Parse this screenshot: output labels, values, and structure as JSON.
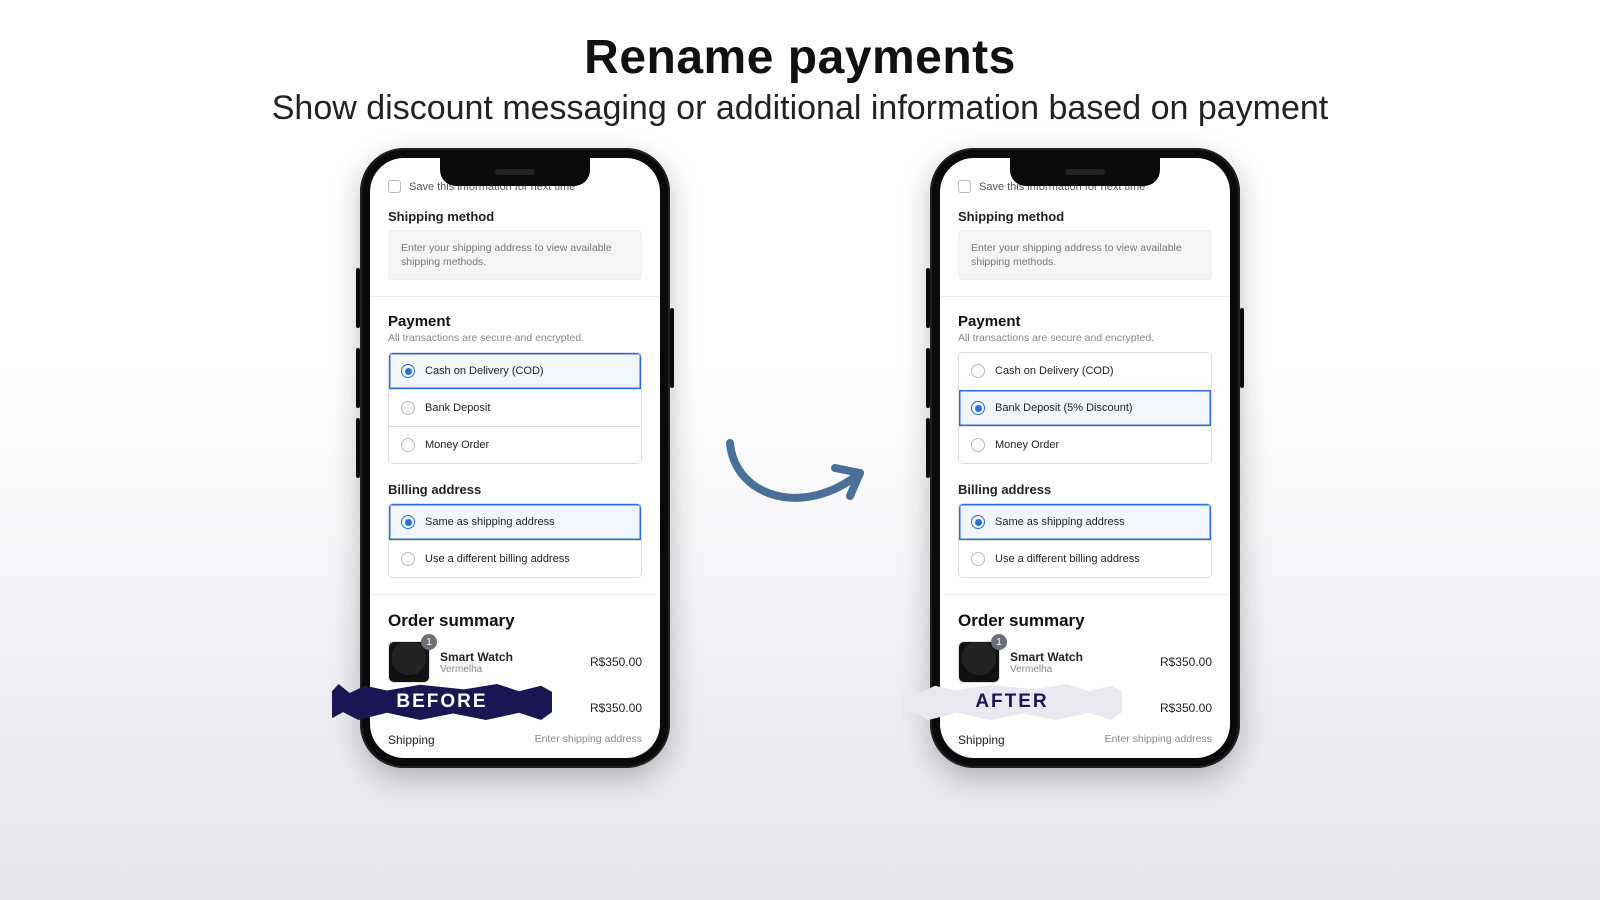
{
  "header": {
    "title": "Rename payments",
    "subtitle": "Show discount messaging or additional information based on payment"
  },
  "labels": {
    "before": "BEFORE",
    "after": "AFTER"
  },
  "checkout": {
    "save_info": "Save this information for next time",
    "shipping_method_title": "Shipping method",
    "shipping_method_hint": "Enter your shipping address to view available shipping methods.",
    "payment_title": "Payment",
    "payment_sub": "All transactions are secure and encrypted.",
    "billing_title": "Billing address",
    "billing_same": "Same as shipping address",
    "billing_diff": "Use a different billing address",
    "summary_title": "Order summary",
    "item_name": "Smart Watch",
    "item_variant": "Vermelha",
    "item_qty": "1",
    "item_price": "R$350.00",
    "subtotal_price": "R$350.00",
    "shipping_label": "Shipping",
    "shipping_value": "Enter shipping address"
  },
  "before_payments": [
    {
      "label": "Cash on Delivery (COD)",
      "selected": true
    },
    {
      "label": "Bank Deposit",
      "selected": false
    },
    {
      "label": "Money Order",
      "selected": false
    }
  ],
  "after_payments": [
    {
      "label": "Cash on Delivery (COD)",
      "selected": false
    },
    {
      "label": "Bank Deposit (5% Discount)",
      "selected": true
    },
    {
      "label": "Money Order",
      "selected": false
    }
  ]
}
